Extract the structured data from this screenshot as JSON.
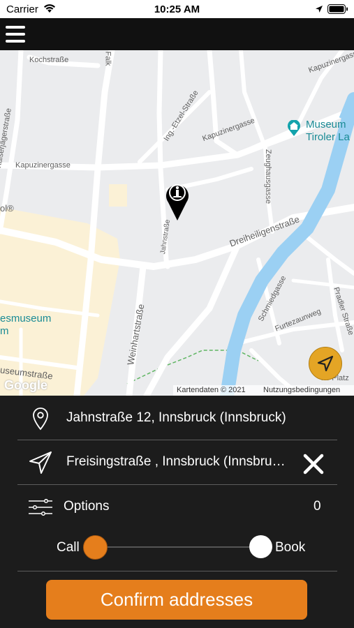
{
  "status_bar": {
    "carrier": "Carrier",
    "time": "10:25 AM"
  },
  "header": {
    "menu_icon": "hamburger-menu-icon"
  },
  "map": {
    "labels": {
      "kochstrasse": "Kochstraße",
      "falk": "Falk",
      "kapuzinergasse_top": "Kapuzinergasse",
      "museum_1": "Museum",
      "museum_2": "Tiroler La",
      "ing_etzel": "Ing.-Etzel-Straße",
      "kapuzinergasse_mid": "Kapuzinergasse",
      "kaiserjaeger": "Kaiserjägerstraße",
      "kapuzinergasse_left": "Kapuzinergasse",
      "zeughaus": "Zeughausgasse",
      "ol": "ol®",
      "jahnstrasse": "Jahnstraße",
      "dreiheiligen": "Dreiheiligenstraße",
      "esmuseum": "esmuseum",
      "m": "m",
      "weinhart": "Weinhartstraße",
      "schmied": "Schmiedgasse",
      "furtenzaun": "Furtezaunweg",
      "pradler": "Pradler Straße",
      "useum": "useumstraße",
      "platz": "ler Platz",
      "google": "Google",
      "map_data": "Kartendaten © 2021",
      "terms": "Nutzungsbedingungen"
    },
    "accent_color": "#e4a525"
  },
  "form": {
    "pickup_address": "Jahnstraße 12, Innsbruck (Innsbruck)",
    "destination_address": "Freisingstraße , Innsbruck (Innsbruck)",
    "options_label": "Options",
    "options_count": "0",
    "call_label": "Call",
    "book_label": "Book",
    "slider_selected": "Call",
    "confirm_label": "Confirm addresses"
  },
  "colors": {
    "accent": "#e57e1c",
    "panel_bg": "#1c1c1c",
    "header_bg": "#111111",
    "river": "#9bd0f3"
  }
}
